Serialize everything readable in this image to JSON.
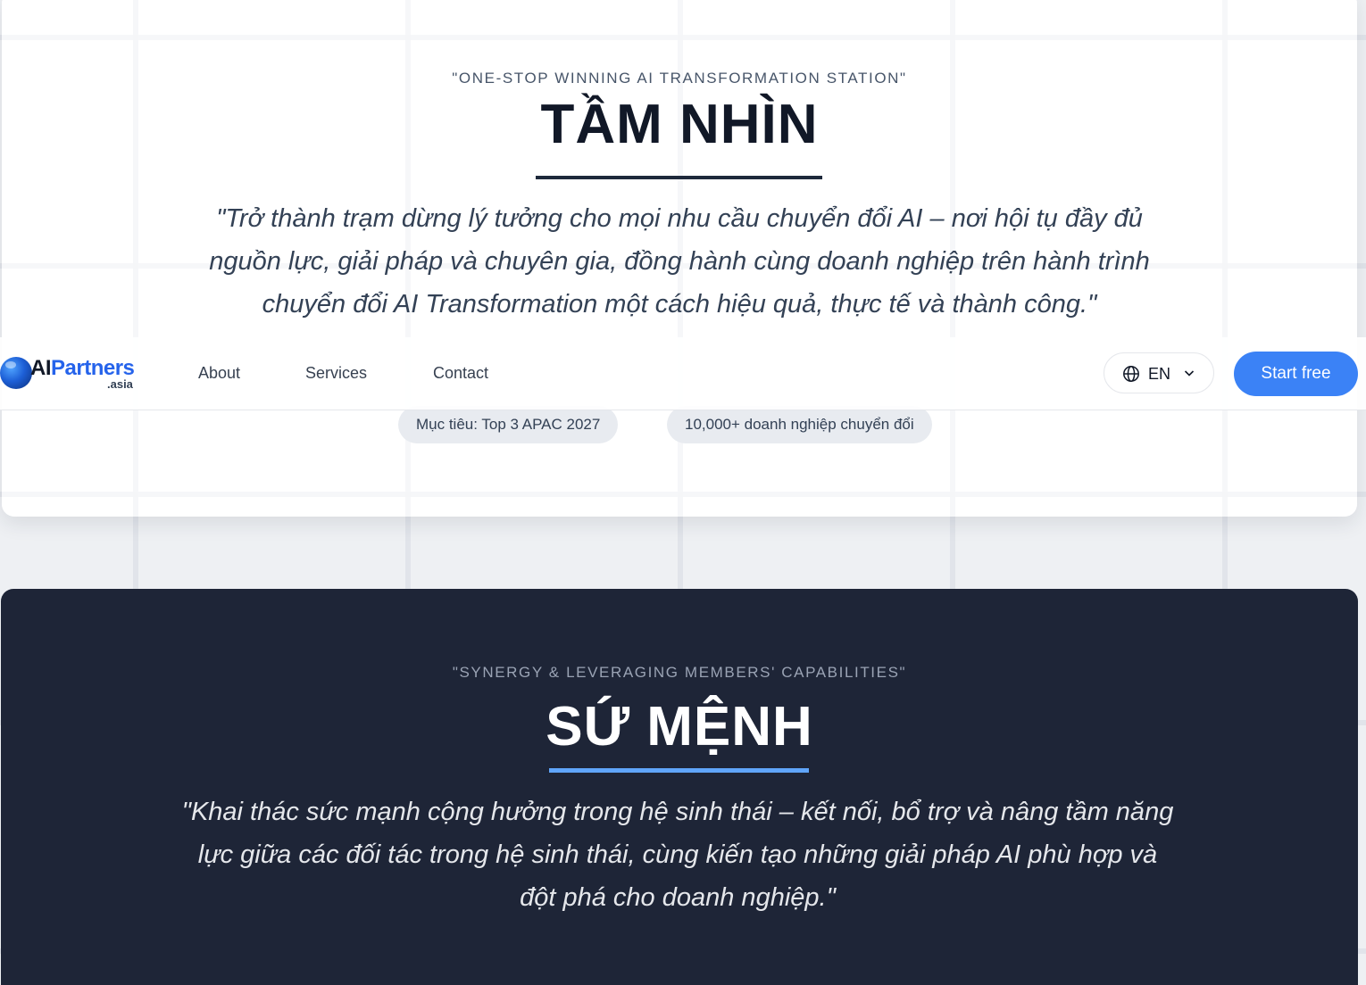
{
  "vision": {
    "eyebrow": "\"ONE-STOP WINNING AI TRANSFORMATION STATION\"",
    "title": "TẦM NHÌN",
    "quote": "\"Trở thành trạm dừng lý tưởng cho mọi nhu cầu chuyển đổi AI – nơi hội tụ đầy đủ nguồn lực, giải pháp và chuyên gia, đồng hành cùng doanh nghiệp trên hành trình chuyển đổi AI Transformation một cách hiệu quả, thực tế và thành công.\"",
    "pills": [
      "Mục tiêu: Top 3 APAC 2027",
      "10,000+ doanh nghiệp chuyển đổi"
    ]
  },
  "navbar": {
    "logo": {
      "ai": "AI",
      "partners": "Partners",
      "sub": ".asia"
    },
    "links": [
      "About",
      "Services",
      "Contact"
    ],
    "language": {
      "code": "EN",
      "icon": "globe-icon"
    },
    "cta_label": "Start free"
  },
  "mission": {
    "eyebrow": "\"SYNERGY & LEVERAGING MEMBERS' CAPABILITIES\"",
    "title": "SỨ MỆNH",
    "quote": "\"Khai thác sức mạnh cộng hưởng trong hệ sinh thái – kết nối, bổ trợ và nâng tầm năng lực giữa các đối tác trong hệ sinh thái, cùng kiến tạo những giải pháp AI phù hợp và đột phá cho doanh nghiệp.\""
  },
  "colors": {
    "accent": "#3b82f6",
    "dark_card": "#1e2537",
    "mission_underline": "#60a5fa"
  }
}
